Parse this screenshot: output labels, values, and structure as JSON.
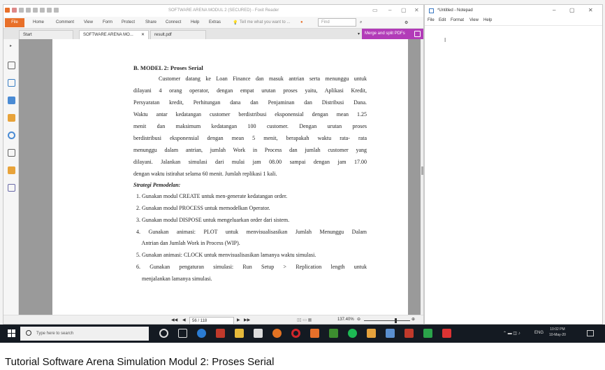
{
  "foxit": {
    "title": "SOFTWARE ARENA MODUL 2 (SECURED) - Foxit Reader",
    "file_label": "File",
    "menu": [
      "Home",
      "Comment",
      "View",
      "Form",
      "Protect",
      "Share",
      "Connect",
      "Help",
      "Extras"
    ],
    "tell_me": "Tell me what you want to ...",
    "find_placeholder": "Find",
    "tabs": [
      "Start",
      "SOFTWARE ARENA MO...",
      "result.pdf"
    ],
    "merge_button": "Merge and split PDFs",
    "page_box": "56 / 118",
    "zoom": "137.40%",
    "accent_color": "#e8702a",
    "merge_color": "#b23bb8"
  },
  "pdf": {
    "heading": "B. MODEL 2: Proses Serial",
    "paragraph": [
      "Customer datang ke Loan Finance dan masuk antrian serta menunggu untuk",
      "dilayani 4 orang operator, dengan empat urutan proses yaitu, Aplikasi Kredit,",
      "Persyaratan kredit, Perhitungan dana dan Penjaminan dan Distribusi Dana.",
      "Waktu antar kedatangan customer berdistribusi eksponensial dengan mean 1.25",
      "menit dan maksimum kedatangan 100 customer. Dengan urutan proses",
      "berdistribusi eksponensial dengan mean 5 menit, berapakah waktu rata- rata",
      "menunggu dalam antrian, jumlah Work in Process dan jumlah customer yang",
      "dilayani. Jalankan simulasi dari mulai jam 08.00 sampai dengan jam 17.00",
      "dengan waktu istirahat selama 60 menit. Jumlah replikasi 1 kali."
    ],
    "strategy_heading": "Strategi Pemodelan:",
    "steps": [
      "1. Gunakan modul CREATE untuk men-generate kedatangan order.",
      "2. Gunakan modul PROCESS untuk memodelkan Operator.",
      "3. Gunakan modul DISPOSE untuk mengeluarkan order dari sistem.",
      "4. Gunakan animasi: PLOT untuk menvisualisasikan Jumlah Menunggu Dalam",
      "    Antrian dan Jumlah Work in Process (WIP).",
      "5. Gunakan animasi: CLOCK untuk menvisualisasikan lamanya waktu simulasi.",
      "6. Gunakan pengaturan simulasi: Run Setup > Replication length untuk",
      "    menjalankan lamanya simulasi."
    ]
  },
  "notepad": {
    "title": "*Untitled - Notepad",
    "menu": [
      "File",
      "Edit",
      "Format",
      "View",
      "Help"
    ]
  },
  "taskbar": {
    "search_placeholder": "Type here to search",
    "language": "ENG",
    "time": "10:02 PM",
    "date": "10-May-20"
  },
  "caption": "Tutorial Software Arena Simulation Modul 2: Proses Serial"
}
